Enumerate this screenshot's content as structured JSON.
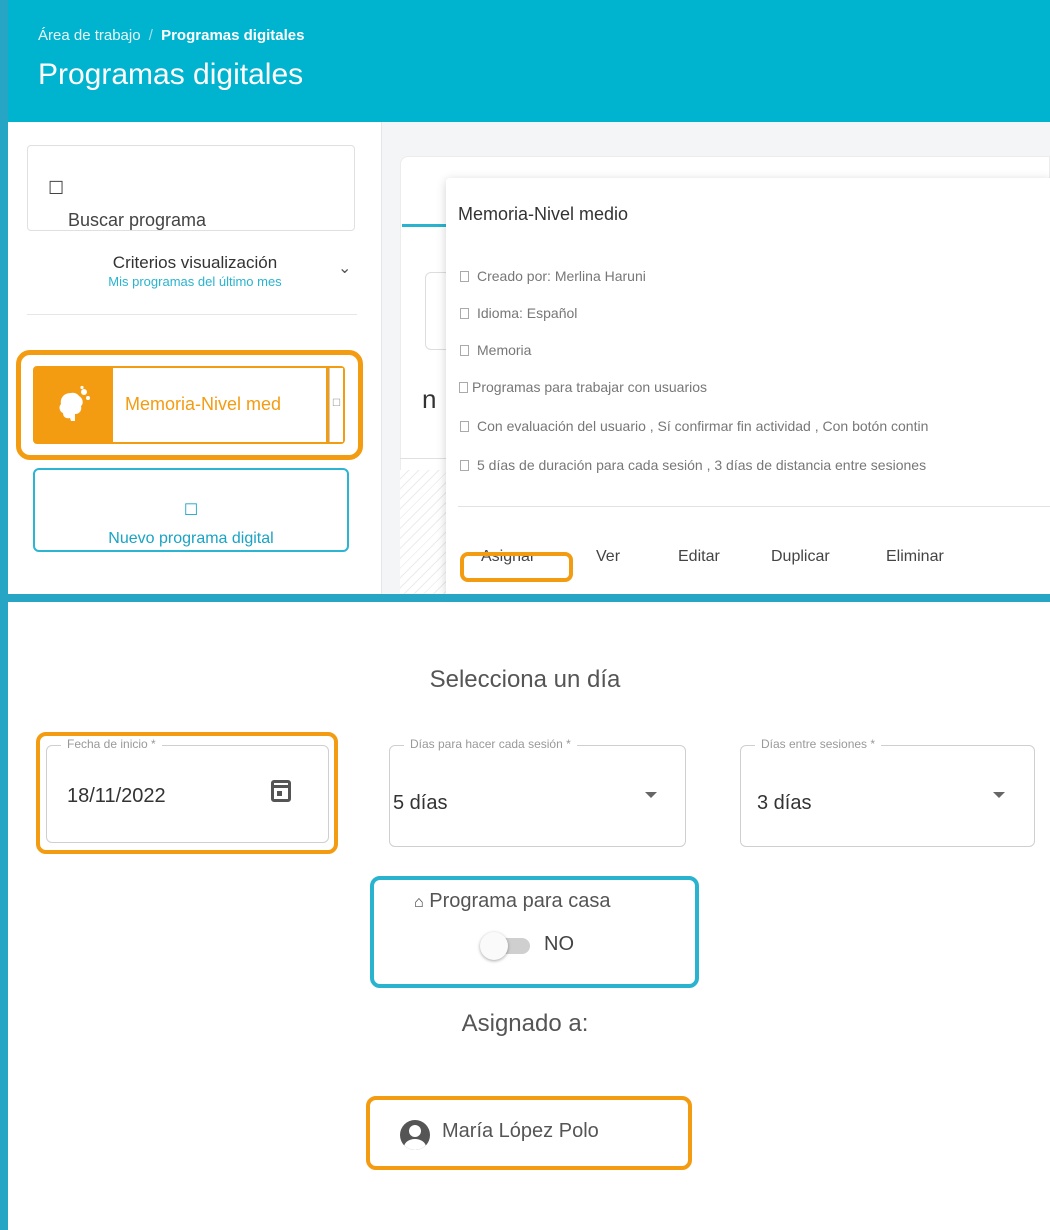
{
  "header": {
    "breadcrumb_root": "Área de trabajo",
    "breadcrumb_sep": "/",
    "breadcrumb_current": "Programas digitales",
    "title": "Programas digitales"
  },
  "sidebar": {
    "search_placeholder": "Buscar programa",
    "criteria_title": "Criterios visualización",
    "criteria_subtitle": "Mis programas del último mes",
    "program_item_label": "Memoria-Nivel med",
    "new_program_label": "Nuevo programa digital"
  },
  "content": {
    "fragment_text": "n"
  },
  "popover": {
    "title": "Memoria-Nivel medio",
    "rows": [
      "Creado por: Merlina Haruni",
      "Idioma: Español",
      "Memoria",
      "Programas para trabajar con usuarios",
      "Con evaluación del usuario , Sí confirmar fin actividad , Con botón contin",
      "5 días de duración para cada sesión , 3 días de distancia entre sesiones"
    ],
    "actions": {
      "assign": "Asignar",
      "view": "Ver",
      "edit": "Editar",
      "duplicate": "Duplicar",
      "delete": "Eliminar"
    }
  },
  "form": {
    "title": "Selecciona un día",
    "start_date": {
      "label": "Fecha de inicio *",
      "value": "18/11/2022"
    },
    "session_days": {
      "label": "Días para hacer cada sesión *",
      "value": "5 días"
    },
    "between_days": {
      "label": "Días entre sesiones *",
      "value": "3 días"
    },
    "home_program": {
      "label": "Programa para casa",
      "toggle_value": "NO",
      "enabled": false
    },
    "assigned_title": "Asignado a:",
    "assigned_user": "María López Polo"
  },
  "colors": {
    "header_teal": "#00b3cf",
    "frame_teal": "#26a6c4",
    "highlight_orange": "#f39c12",
    "accent_teal": "#29b3cf"
  }
}
